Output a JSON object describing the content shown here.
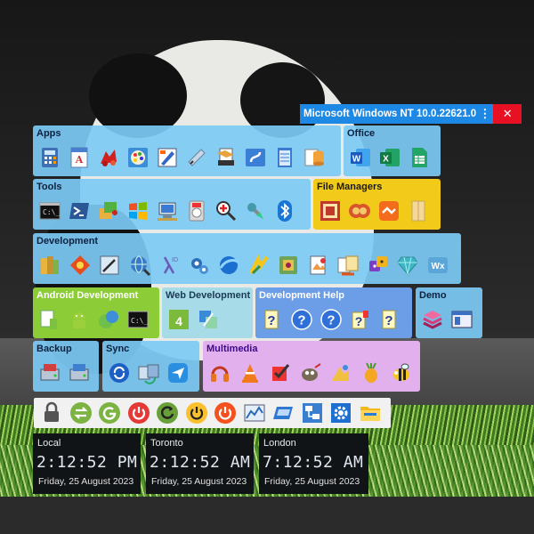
{
  "titlebar": {
    "title": "Microsoft Windows NT 10.0.22621.0",
    "menu_glyph": "⋮",
    "close_glyph": "✕"
  },
  "groups": {
    "apps": {
      "label": "Apps",
      "icons": [
        "calculator-icon",
        "wordpad-icon",
        "paint-icon",
        "color-palette-icon",
        "paint-app-icon",
        "tablet-pen-icon",
        "document-scanner-icon",
        "character-map-icon",
        "notepad-icon",
        "data-stack-icon"
      ]
    },
    "office": {
      "label": "Office",
      "icons": [
        "word-icon",
        "excel-icon",
        "sheets-icon"
      ]
    },
    "tools": {
      "label": "Tools",
      "icons": [
        "command-prompt-icon",
        "powershell-icon",
        "install-icon",
        "windows-logo-icon",
        "network-computer-icon",
        "media-player-icon",
        "magnifier-icon",
        "cleanup-icon",
        "bluetooth-icon"
      ]
    },
    "file_managers": {
      "label": "File Managers",
      "icons": [
        "total-commander-icon",
        "double-commander-icon",
        "transfer-icon",
        "file-folder-icon"
      ]
    },
    "development": {
      "label": "Development",
      "icons": [
        "ide-books-icon",
        "code-diamond-icon",
        "editor-pen-icon",
        "globe-search-icon",
        "lambda-icon",
        "gears-icon",
        "browser-icon",
        "wing-icon",
        "package-icon",
        "image-editor-icon",
        "transfer-docs-icon",
        "dice-icon",
        "gem-icon",
        "wx-icon"
      ]
    },
    "android": {
      "label": "Android Development",
      "icons": [
        "android-install-icon",
        "android-icon",
        "android-orb-icon",
        "android-terminal-icon"
      ]
    },
    "web": {
      "label": "Web Development",
      "icons": [
        "web-editor-icon",
        "web-transfer-icon"
      ]
    },
    "devhelp": {
      "label": "Development Help",
      "icons": [
        "help-file-icon",
        "help-circle-icon",
        "help-circle-icon",
        "help-book-icon",
        "help-file-icon"
      ]
    },
    "demo": {
      "label": "Demo",
      "icons": [
        "stack-layers-icon",
        "window-demo-icon"
      ]
    },
    "backup": {
      "label": "Backup",
      "icons": [
        "backup-drive-icon",
        "restore-drive-icon"
      ]
    },
    "sync": {
      "label": "Sync",
      "icons": [
        "sync-circle-icon",
        "sync-files-icon",
        "send-icon"
      ]
    },
    "multimedia": {
      "label": "Multimedia",
      "icons": [
        "headphones-icon",
        "vlc-icon",
        "check-box-icon",
        "gimp-icon",
        "media-tools-icon",
        "fruit-icon",
        "bee-icon"
      ]
    }
  },
  "power": {
    "icons": [
      "lock-icon",
      "switch-user-icon",
      "sign-out-icon",
      "power-off-icon",
      "restart-icon",
      "sleep-icon",
      "shutdown-icon",
      "chart-icon",
      "window-icon",
      "network-icon",
      "settings-icon",
      "explorer-icon"
    ]
  },
  "clocks": [
    {
      "city": "Local",
      "time": "2:12:52 PM",
      "date": "Friday, 25 August 2023"
    },
    {
      "city": "Toronto",
      "time": "2:12:52 AM",
      "date": "Friday, 25 August 2023"
    },
    {
      "city": "London",
      "time": "7:12:52 AM",
      "date": "Friday, 25 August 2023"
    }
  ],
  "help_glyph": "?",
  "wx_text": "Wx",
  "colors": {
    "titlebar": "#1e88e5",
    "close": "#e81123",
    "group_blue": "#7dcaf5",
    "file_managers": "#f2cb1a",
    "android": "#8ccc36",
    "web": "#a8dbe8",
    "devhelp": "#6c9ee8",
    "multimedia": "#e3b0ee"
  }
}
